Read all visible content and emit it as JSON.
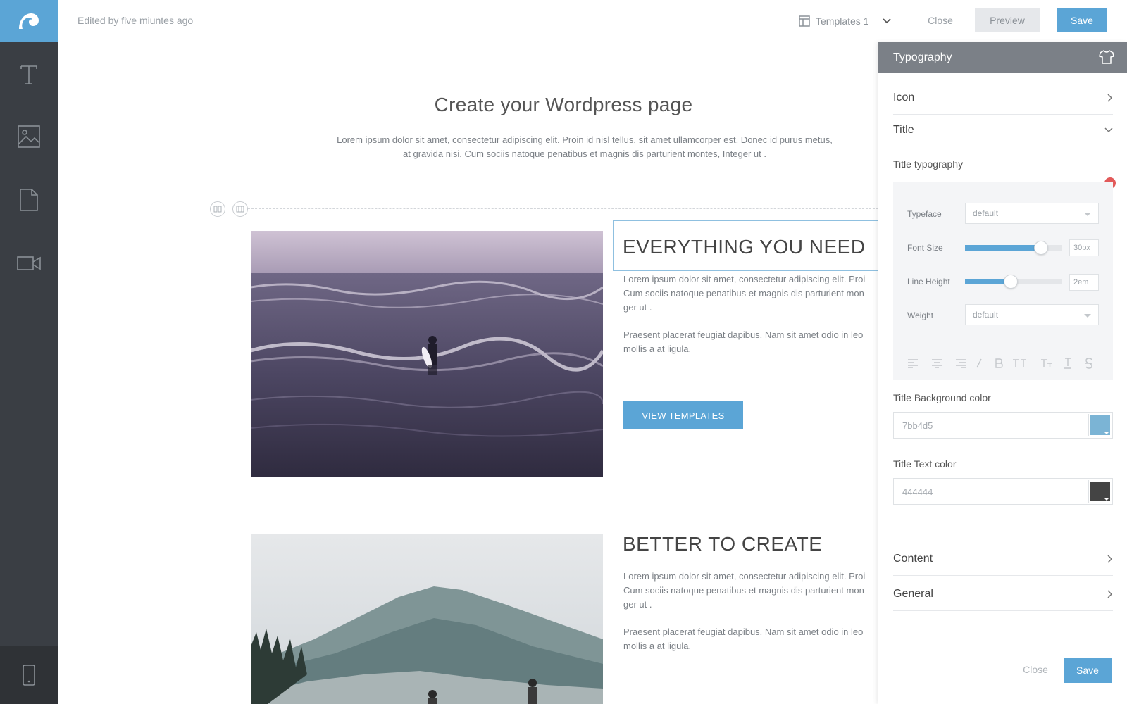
{
  "topbar": {
    "edited_text": "Edited by five miuntes ago",
    "template_select": "Templates 1",
    "close_label": "Close",
    "preview_label": "Preview",
    "save_label": "Save"
  },
  "sidebar": {
    "tools": [
      "text-tool",
      "image-tool",
      "page-tool",
      "video-tool"
    ],
    "bottom_tool": "mobile-preview"
  },
  "canvas": {
    "title": "Create your Wordpress page",
    "subtitle_line1": "Lorem ipsum dolor sit amet, consectetur adipiscing elit. Proin id nisl tellus, sit amet ullamcorper est. Donec id purus metus,",
    "subtitle_line2": "at gravida nisi. Cum sociis natoque penatibus et magnis dis parturient montes, Integer ut .",
    "sections": [
      {
        "title": "EVERYTHING YOU NEED",
        "para1_line1": "Lorem ipsum dolor sit amet, consectetur adipiscing elit. Proi",
        "para1_line2": "Cum sociis natoque penatibus et magnis dis parturient mon",
        "para1_line3": "ger ut .",
        "para2_line1": "Praesent placerat feugiat dapibus. Nam sit amet odio in leo",
        "para2_line2": "mollis a at ligula.",
        "button": "VIEW TEMPLATES"
      },
      {
        "title": "BETTER TO CREATE",
        "para1_line1": "Lorem ipsum dolor sit amet, consectetur adipiscing elit. Proi",
        "para1_line2": "Cum sociis natoque penatibus et magnis dis parturient mon",
        "para1_line3": "ger ut .",
        "para2_line1": "Praesent placerat feugiat dapibus. Nam sit amet odio in leo",
        "para2_line2": "mollis a at ligula."
      }
    ]
  },
  "panel": {
    "header": "Typography",
    "accordion": {
      "icon": "Icon",
      "title": "Title",
      "content": "Content",
      "general": "General"
    },
    "title_typography_label": "Title typography",
    "typeface": {
      "label": "Typeface",
      "value": "default"
    },
    "font_size": {
      "label": "Font Size",
      "value": "30px",
      "level": 0.78
    },
    "line_height": {
      "label": "Line Height",
      "value": "2em",
      "level": 0.47
    },
    "weight": {
      "label": "Weight",
      "value": "default"
    },
    "format_icons": [
      "align-left-icon",
      "align-center-icon",
      "align-right-icon",
      "italic-icon",
      "bold-icon",
      "uppercase-icon",
      "small-caps-icon",
      "underline-icon",
      "strikethrough-icon"
    ],
    "bg_color": {
      "label": "Title Background color",
      "value": "7bb4d5",
      "swatch": "#7bb4d5"
    },
    "text_color": {
      "label": "Title Text color",
      "value": "444444",
      "swatch": "#444444"
    },
    "close_label": "Close",
    "save_label": "Save"
  },
  "colors": {
    "accent": "#5ba5d6",
    "rail": "#3a3e44",
    "panel_header": "#7b8087"
  }
}
